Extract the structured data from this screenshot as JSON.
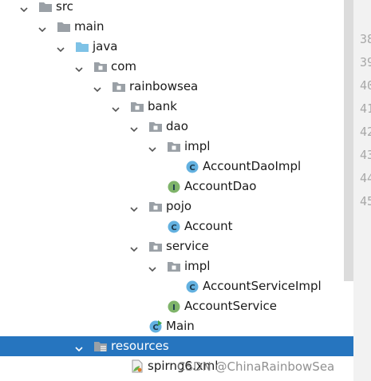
{
  "tree": [
    {
      "label": "src",
      "level": 0,
      "icon": "folder-icon",
      "expanded": true
    },
    {
      "label": "main",
      "level": 1,
      "icon": "folder-icon",
      "expanded": true
    },
    {
      "label": "java",
      "level": 2,
      "icon": "source-folder-icon",
      "expanded": true
    },
    {
      "label": "com",
      "level": 3,
      "icon": "package-icon",
      "expanded": true
    },
    {
      "label": "rainbowsea",
      "level": 4,
      "icon": "package-icon",
      "expanded": true
    },
    {
      "label": "bank",
      "level": 5,
      "icon": "package-icon",
      "expanded": true
    },
    {
      "label": "dao",
      "level": 6,
      "icon": "package-icon",
      "expanded": true
    },
    {
      "label": "impl",
      "level": 7,
      "icon": "package-icon",
      "expanded": true
    },
    {
      "label": "AccountDaoImpl",
      "level": 8,
      "icon": "class-icon",
      "badge": "C"
    },
    {
      "label": "AccountDao",
      "level": 7,
      "icon": "interface-icon",
      "badge": "I"
    },
    {
      "label": "pojo",
      "level": 6,
      "icon": "package-icon",
      "expanded": true
    },
    {
      "label": "Account",
      "level": 7,
      "icon": "class-icon",
      "badge": "C"
    },
    {
      "label": "service",
      "level": 6,
      "icon": "package-icon",
      "expanded": true
    },
    {
      "label": "impl",
      "level": 7,
      "icon": "package-icon",
      "expanded": true
    },
    {
      "label": "AccountServiceImpl",
      "level": 8,
      "icon": "class-icon",
      "badge": "C"
    },
    {
      "label": "AccountService",
      "level": 7,
      "icon": "interface-icon",
      "badge": "I"
    },
    {
      "label": "Main",
      "level": 6,
      "icon": "main-class-icon",
      "badge": "C"
    },
    {
      "label": "resources",
      "level": 3,
      "icon": "resources-folder-icon",
      "expanded": true,
      "selected": true
    },
    {
      "label": "spirng6.xml",
      "level": 5,
      "icon": "xml-file-icon"
    }
  ],
  "gutter": {
    "lines": [
      "38",
      "39",
      "40",
      "41",
      "42",
      "43",
      "44",
      "45"
    ]
  },
  "watermark": "CSDN @ChinaRainbowSea",
  "colors": {
    "selection": "#2675bf",
    "class_badge": "#63b1e0",
    "interface_badge": "#7fb46a",
    "folder": "#9aa0a6",
    "source_folder": "#7ec2e6"
  }
}
